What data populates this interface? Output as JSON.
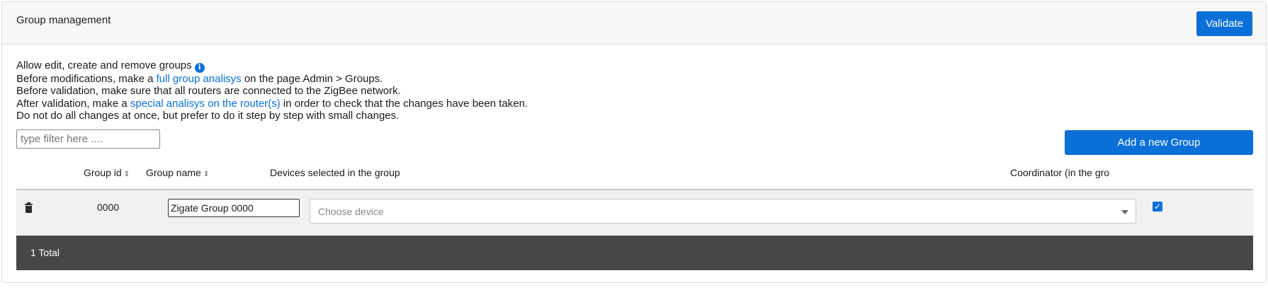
{
  "header": {
    "title": "Group management",
    "validate_label": "Validate"
  },
  "intro": {
    "line1": "Allow edit, create and remove groups",
    "line2_pre": "Before modifications, make a ",
    "line2_link": "full group analisys",
    "line2_post": " on the page Admin > Groups.",
    "line3": "Before validation, make sure that all routers are connected to the ZigBee network.",
    "line4_pre": "After validation, make a ",
    "line4_link": "special analisys on the router(s)",
    "line4_post": " in order to check that the changes have been taken.",
    "line5": "Do not do all changes at once, but prefer to do it step by step with small changes."
  },
  "filter": {
    "placeholder": "type filter here ...."
  },
  "add_group_label": "Add a new Group",
  "table": {
    "columns": {
      "group_id": "Group id",
      "group_name": "Group name",
      "devices": "Devices selected in the group",
      "coordinator": "Coordinator (in the gro"
    },
    "rows": [
      {
        "group_id": "0000",
        "group_name": "Zigate Group 0000",
        "devices_placeholder": "Choose device",
        "coordinator_checked": true
      }
    ],
    "footer": "1 Total"
  },
  "colors": {
    "accent": "#0a70d8",
    "footer_bg": "#474747"
  },
  "icons": {
    "info": "info-icon",
    "sort": "sort-icon",
    "delete": "trash-icon",
    "dropdown": "chevron-down-icon",
    "checkbox": "checkbox-checked-icon"
  }
}
